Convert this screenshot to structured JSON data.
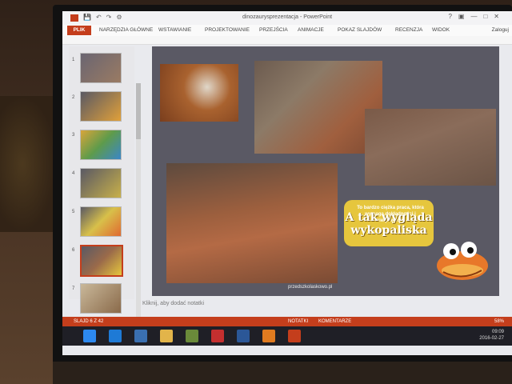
{
  "app": {
    "title": "dinozaurysprezentacja - PowerPoint",
    "file_tab": "PLIK",
    "tabs": [
      "NARZĘDZIA GŁÓWNE",
      "WSTAWIANIE",
      "PROJEKTOWANIE",
      "PRZEJŚCIA",
      "ANIMACJE",
      "POKAZ SLAJDÓW",
      "RECENZJA",
      "WIDOK"
    ],
    "login": "Zaloguj"
  },
  "thumbnails": {
    "numbers": [
      "1",
      "2",
      "3",
      "4",
      "5",
      "6",
      "7"
    ],
    "selected_index": 6
  },
  "slide": {
    "credit": "przedszkolaskowo.pl",
    "bubble_small": "To bardzo ciężka praca, która wymaga dokładności i cierpliwości",
    "bubble_big": "A tak wygląda wykopaliska"
  },
  "notes": {
    "placeholder": "Kliknij, aby dodać notatki"
  },
  "status": {
    "slide_info": "SLAJD 6 Z 42",
    "notes_label": "NOTATKI",
    "comments_label": "KOMENTARZE",
    "zoom": "58%"
  },
  "taskbar": {
    "time": "09:09",
    "date": "2016-02-27"
  },
  "colors": {
    "accent": "#c43e1c",
    "slide_bg": "#5a5964",
    "bubble": "#e6c63d"
  }
}
